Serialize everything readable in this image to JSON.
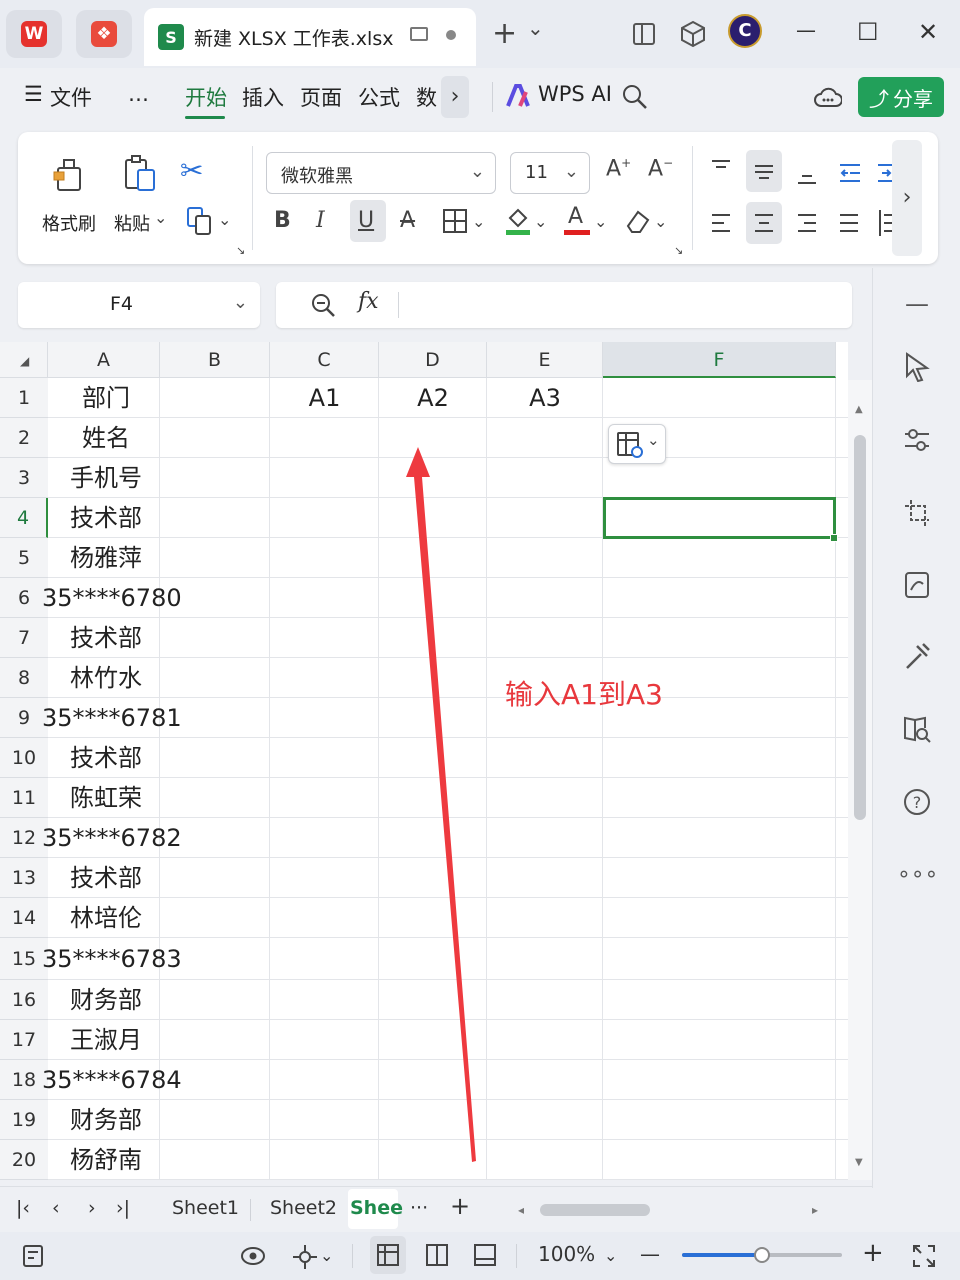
{
  "titlebar": {
    "tab_title": "新建 XLSX 工作表.xlsx",
    "tab_badge": "S",
    "new_tab": "+",
    "new_tab_menu": "⌄",
    "minimize": "—",
    "maximize": "☐",
    "close": "✕"
  },
  "menubar": {
    "items": [
      "文件",
      "…",
      "开始",
      "插入",
      "页面",
      "公式",
      "数"
    ],
    "more": "›",
    "ai_label": "WPS AI",
    "share_label": "分享"
  },
  "ribbon": {
    "format_painter": "格式刷",
    "paste": "粘贴",
    "font_name": "微软雅黑",
    "font_size": "11",
    "bold": "B",
    "italic": "I",
    "underline": "U",
    "strike": "A",
    "font_color": "A"
  },
  "formula_bar": {
    "cell_ref": "F4",
    "fx": "fx",
    "formula": ""
  },
  "grid": {
    "columns": [
      "A",
      "B",
      "C",
      "D",
      "E",
      "F"
    ],
    "selected_column": "F",
    "selected_row": "4",
    "rows": [
      {
        "num": "1",
        "a": "部门",
        "c": "A1",
        "d": "A2",
        "e": "A3"
      },
      {
        "num": "2",
        "a": "姓名"
      },
      {
        "num": "3",
        "a": "手机号"
      },
      {
        "num": "4",
        "a": "技术部"
      },
      {
        "num": "5",
        "a": "杨雅萍"
      },
      {
        "num": "6",
        "a": "35****6780"
      },
      {
        "num": "7",
        "a": "技术部"
      },
      {
        "num": "8",
        "a": "林竹水"
      },
      {
        "num": "9",
        "a": "35****6781"
      },
      {
        "num": "10",
        "a": "技术部"
      },
      {
        "num": "11",
        "a": "陈虹荣"
      },
      {
        "num": "12",
        "a": "35****6782"
      },
      {
        "num": "13",
        "a": "技术部"
      },
      {
        "num": "14",
        "a": "林培伦"
      },
      {
        "num": "15",
        "a": "35****6783"
      },
      {
        "num": "16",
        "a": "财务部"
      },
      {
        "num": "17",
        "a": "王淑月"
      },
      {
        "num": "18",
        "a": "35****6784"
      },
      {
        "num": "19",
        "a": "财务部"
      },
      {
        "num": "20",
        "a": "杨舒南"
      }
    ],
    "annotation": "输入A1到A3",
    "annotation_color": "#e8383d"
  },
  "sheets": {
    "tabs": [
      "Sheet1",
      "Sheet2",
      "Shee"
    ],
    "active": "Shee",
    "more": "···",
    "add": "+"
  },
  "statusbar": {
    "zoom": "100%",
    "zoom_out": "—",
    "zoom_in": "+",
    "zoom_fraction": 0.5
  },
  "colors": {
    "accent": "#1f8a4c",
    "selection": "#2f8f3f",
    "zoom_slider": "#2a6fd6"
  }
}
